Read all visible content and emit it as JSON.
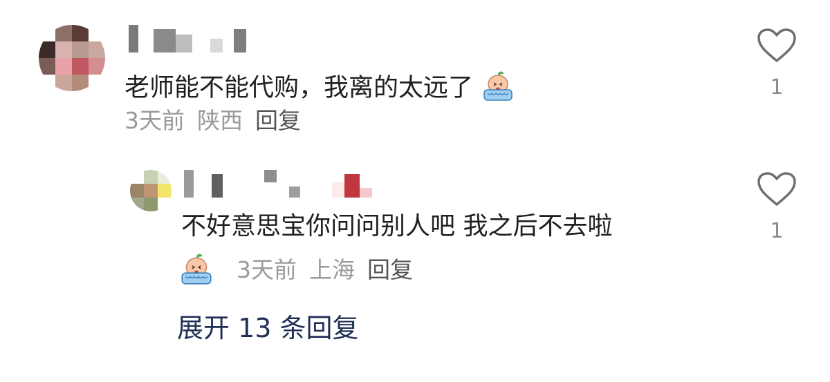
{
  "comment": {
    "text": "老师能不能代购，我离的太远了",
    "emoji": "crying-emoji",
    "time": "3天前",
    "location": "陕西",
    "reply_label": "回复",
    "like_count": "1"
  },
  "reply": {
    "text": "不好意思宝你问问别人吧 我之后不去啦",
    "emoji": "crying-emoji",
    "time": "3天前",
    "location": "上海",
    "reply_label": "回复",
    "like_count": "1"
  },
  "expand_label": "展开 13 条回复",
  "colors": {
    "like_icon": "#6f6f6f",
    "meta_text": "#9a9a9a",
    "expand_text": "#1f2f55"
  }
}
